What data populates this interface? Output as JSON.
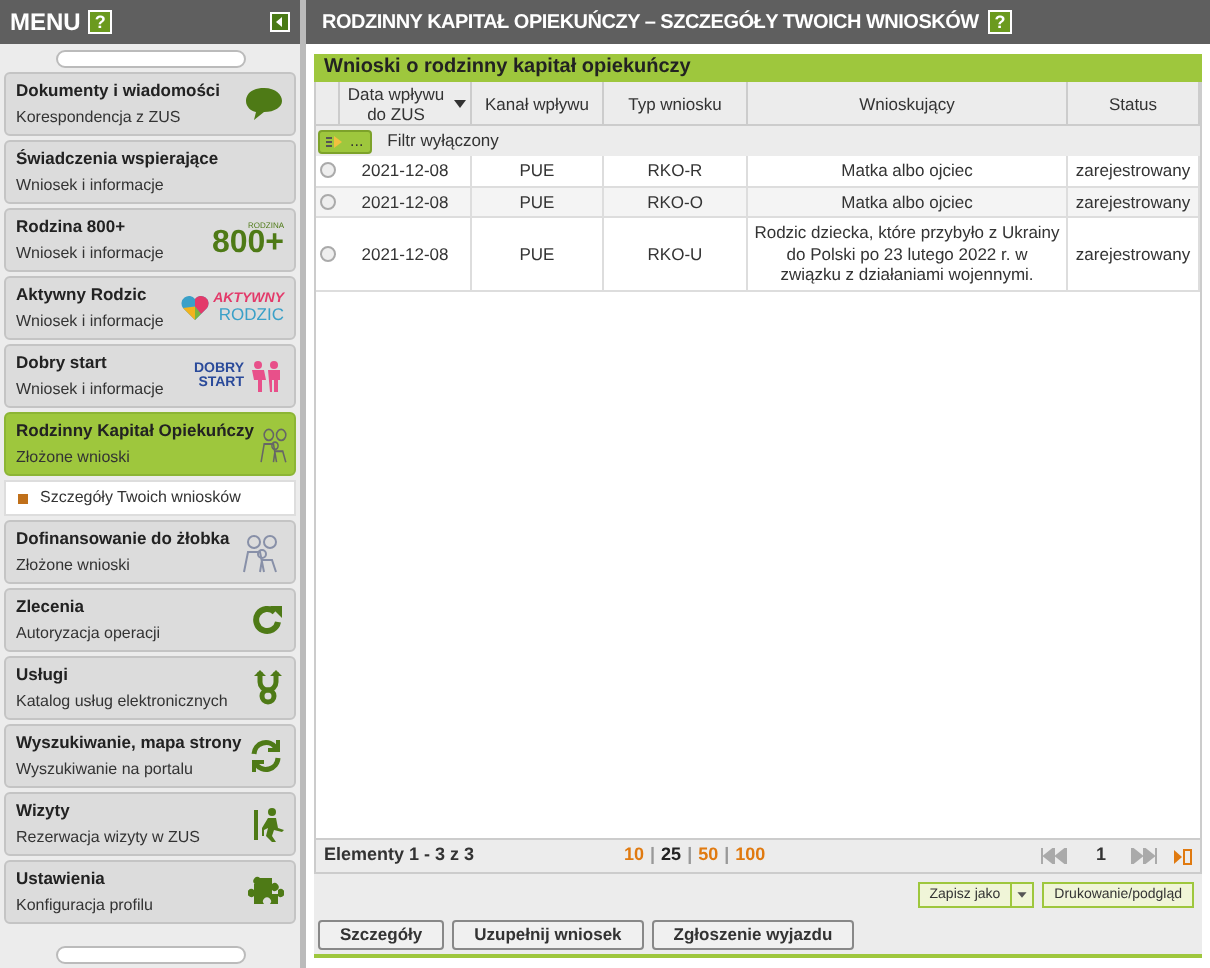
{
  "menu": {
    "title": "MENU",
    "help": "?",
    "items": [
      {
        "title": "Dokumenty i wiadomości",
        "subtitle": "Korespondencja z ZUS",
        "selected": false
      },
      {
        "title": "Świadczenia wspierające",
        "subtitle": "Wniosek i informacje",
        "selected": false
      },
      {
        "title": "Rodzina 800+",
        "subtitle": "Wniosek i informacje",
        "selected": false,
        "logo": [
          "RODZINA",
          "800+"
        ]
      },
      {
        "title": "Aktywny Rodzic",
        "subtitle": "Wniosek i informacje",
        "selected": false,
        "logo": [
          "AKTYWNY",
          "RODZIC"
        ]
      },
      {
        "title": "Dobry start",
        "subtitle": "Wniosek i informacje",
        "selected": false,
        "logo": [
          "DOBRY",
          "START"
        ]
      },
      {
        "title": "Rodzinny Kapitał Opiekuńczy",
        "subtitle": "Złożone wnioski",
        "selected": true,
        "children": [
          {
            "label": "Szczegóły Twoich wniosków",
            "selected": true
          }
        ]
      },
      {
        "title": "Dofinansowanie do żłobka",
        "subtitle": "Złożone wnioski",
        "selected": false
      },
      {
        "title": "Zlecenia",
        "subtitle": "Autoryzacja operacji",
        "selected": false
      },
      {
        "title": "Usługi",
        "subtitle": "Katalog usług elektronicznych",
        "selected": false
      },
      {
        "title": "Wyszukiwanie, mapa strony",
        "subtitle": "Wyszukiwanie na portalu",
        "selected": false
      },
      {
        "title": "Wizyty",
        "subtitle": "Rezerwacja wizyty w ZUS",
        "selected": false
      },
      {
        "title": "Ustawienia",
        "subtitle": "Konfiguracja profilu",
        "selected": false
      }
    ]
  },
  "page": {
    "title": "RODZINNY KAPITAŁ OPIEKUŃCZY – SZCZEGÓŁY TWOICH WNIOSKÓW",
    "help": "?"
  },
  "table": {
    "title": "Wnioski o rodzinny kapitał opiekuńczy",
    "columns": [
      "Data wpływu do ZUS",
      "Kanał wpływu",
      "Typ wniosku",
      "Wnioskujący",
      "Status"
    ],
    "filter_button": "...",
    "filter_status": "Filtr wyłączony",
    "rows": [
      {
        "selected": false,
        "cells": [
          "2021-12-08",
          "PUE",
          "RKO-R",
          "Matka albo ojciec",
          "zarejestrowany"
        ]
      },
      {
        "selected": false,
        "cells": [
          "2021-12-08",
          "PUE",
          "RKO-O",
          "Matka albo ojciec",
          "zarejestrowany"
        ]
      },
      {
        "selected": false,
        "cells": [
          "2021-12-08",
          "PUE",
          "RKO-U",
          "Rodzic dziecka, które przybyło z Ukrainy do Polski po 23 lutego 2022 r. w związku z działaniami wojennymi.",
          "zarejestrowany"
        ]
      }
    ],
    "items_info": "Elementy 1 - 3 z 3",
    "page_sizes": [
      {
        "label": "10",
        "selected": false
      },
      {
        "label": "25",
        "selected": true
      },
      {
        "label": "50",
        "selected": false
      },
      {
        "label": "100",
        "selected": false
      }
    ],
    "page_size_separator": "|",
    "current_page": "1",
    "save_as": "Zapisz jako",
    "print": "Drukowanie/podgląd"
  },
  "buttons": [
    "Szczegóły",
    "Uzupełnij wniosek",
    "Zgłoszenie wyjazdu"
  ]
}
